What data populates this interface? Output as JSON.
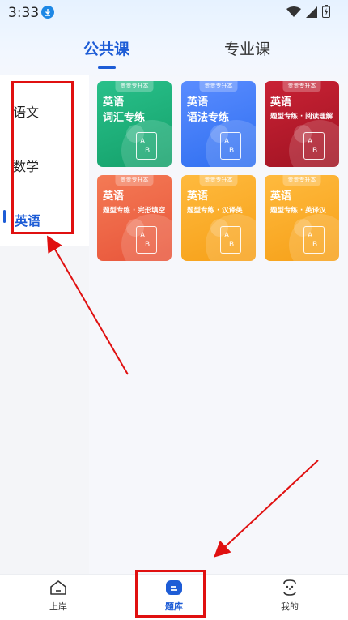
{
  "status_bar": {
    "time": "3:33"
  },
  "top_tabs": [
    {
      "label": "公共课",
      "active": true
    },
    {
      "label": "专业课",
      "active": false
    }
  ],
  "sidebar": {
    "items": [
      {
        "label": "语文",
        "active": false
      },
      {
        "label": "数学",
        "active": false
      },
      {
        "label": "英语",
        "active": true
      }
    ]
  },
  "cards": [
    {
      "badge": "贵贵专升本",
      "subject": "英语",
      "title": "词汇专练",
      "color": "#14a06a",
      "color2": "#29c08a"
    },
    {
      "badge": "贵贵专升本",
      "subject": "英语",
      "title": "语法专练",
      "color": "#2f6ff0",
      "color2": "#5a8cff"
    },
    {
      "badge": "贵贵专升本",
      "subject": "英语",
      "title": "题型专练 · 阅读理解",
      "color": "#a01322",
      "color2": "#c92235"
    },
    {
      "badge": "贵贵专升本",
      "subject": "英语",
      "title": "题型专练 · 完形填空",
      "color": "#e8553a",
      "color2": "#f47a55"
    },
    {
      "badge": "贵贵专升本",
      "subject": "英语",
      "title": "题型专练 · 汉译英",
      "color": "#f6a018",
      "color2": "#ffba3e"
    },
    {
      "badge": "贵贵专升本",
      "subject": "英语",
      "title": "题型专练 · 英译汉",
      "color": "#f6a018",
      "color2": "#ffba3e"
    }
  ],
  "doc_icon": {
    "letter_a": "A",
    "letter_b": "B"
  },
  "bottom_nav": [
    {
      "label": "上岸",
      "icon": "home-icon",
      "active": false
    },
    {
      "label": "题库",
      "icon": "question-bank-icon",
      "active": true
    },
    {
      "label": "我的",
      "icon": "profile-icon",
      "active": false
    }
  ],
  "colors": {
    "accent": "#1d5cd6",
    "annotation": "#e01010"
  }
}
